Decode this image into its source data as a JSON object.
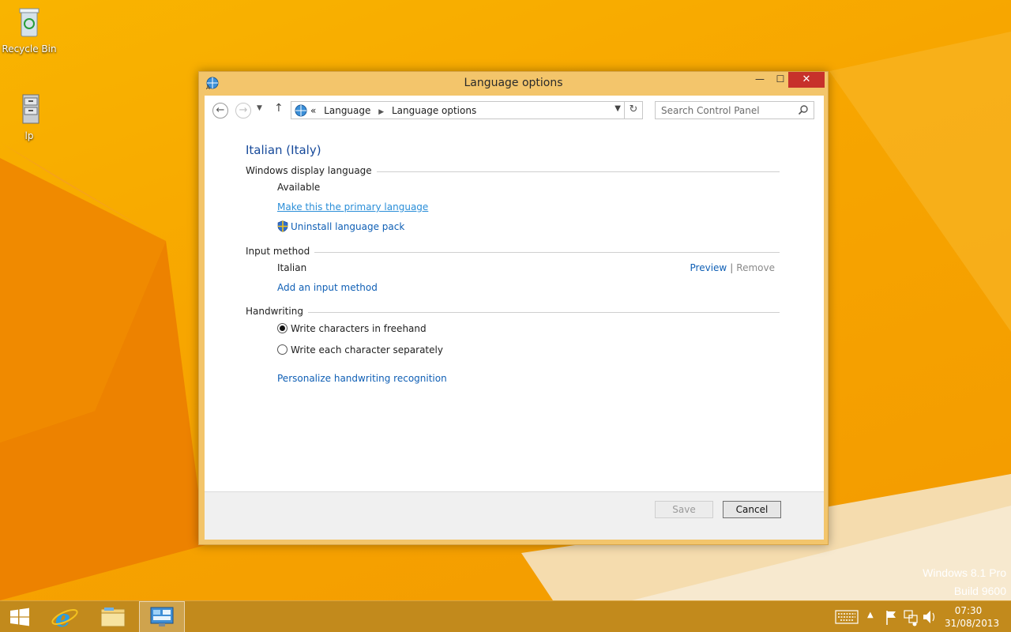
{
  "desktop": {
    "icons": [
      {
        "label": "Recycle Bin",
        "icon": "recycle-bin-icon"
      },
      {
        "label": "lp",
        "icon": "file-cabinet-icon"
      }
    ],
    "watermark": {
      "line1": "Windows 8.1 Pro",
      "line2": "Build 9600"
    }
  },
  "window": {
    "title": "Language options",
    "controls": {
      "minimize": "—",
      "maximize": "☐",
      "close": "✕"
    }
  },
  "navbar": {
    "breadcrumb_prefix": "«",
    "breadcrumbs": [
      "Language",
      "Language options"
    ],
    "search_placeholder": "Search Control Panel"
  },
  "content": {
    "heading": "Italian (Italy)",
    "display_language": {
      "section_label": "Windows display language",
      "status": "Available",
      "make_primary": "Make this the primary language",
      "uninstall": "Uninstall language pack"
    },
    "input_method": {
      "section_label": "Input method",
      "method_name": "Italian",
      "preview": "Preview",
      "separator": "|",
      "remove": "Remove",
      "add": "Add an input method"
    },
    "handwriting": {
      "section_label": "Handwriting",
      "option_freehand": "Write characters in freehand",
      "option_separate": "Write each character separately",
      "selected": "freehand",
      "personalize": "Personalize handwriting recognition"
    }
  },
  "footer": {
    "save": "Save",
    "cancel": "Cancel"
  },
  "taskbar": {
    "time": "07:30",
    "date": "31/08/2013",
    "accent": "#c28a1c"
  }
}
